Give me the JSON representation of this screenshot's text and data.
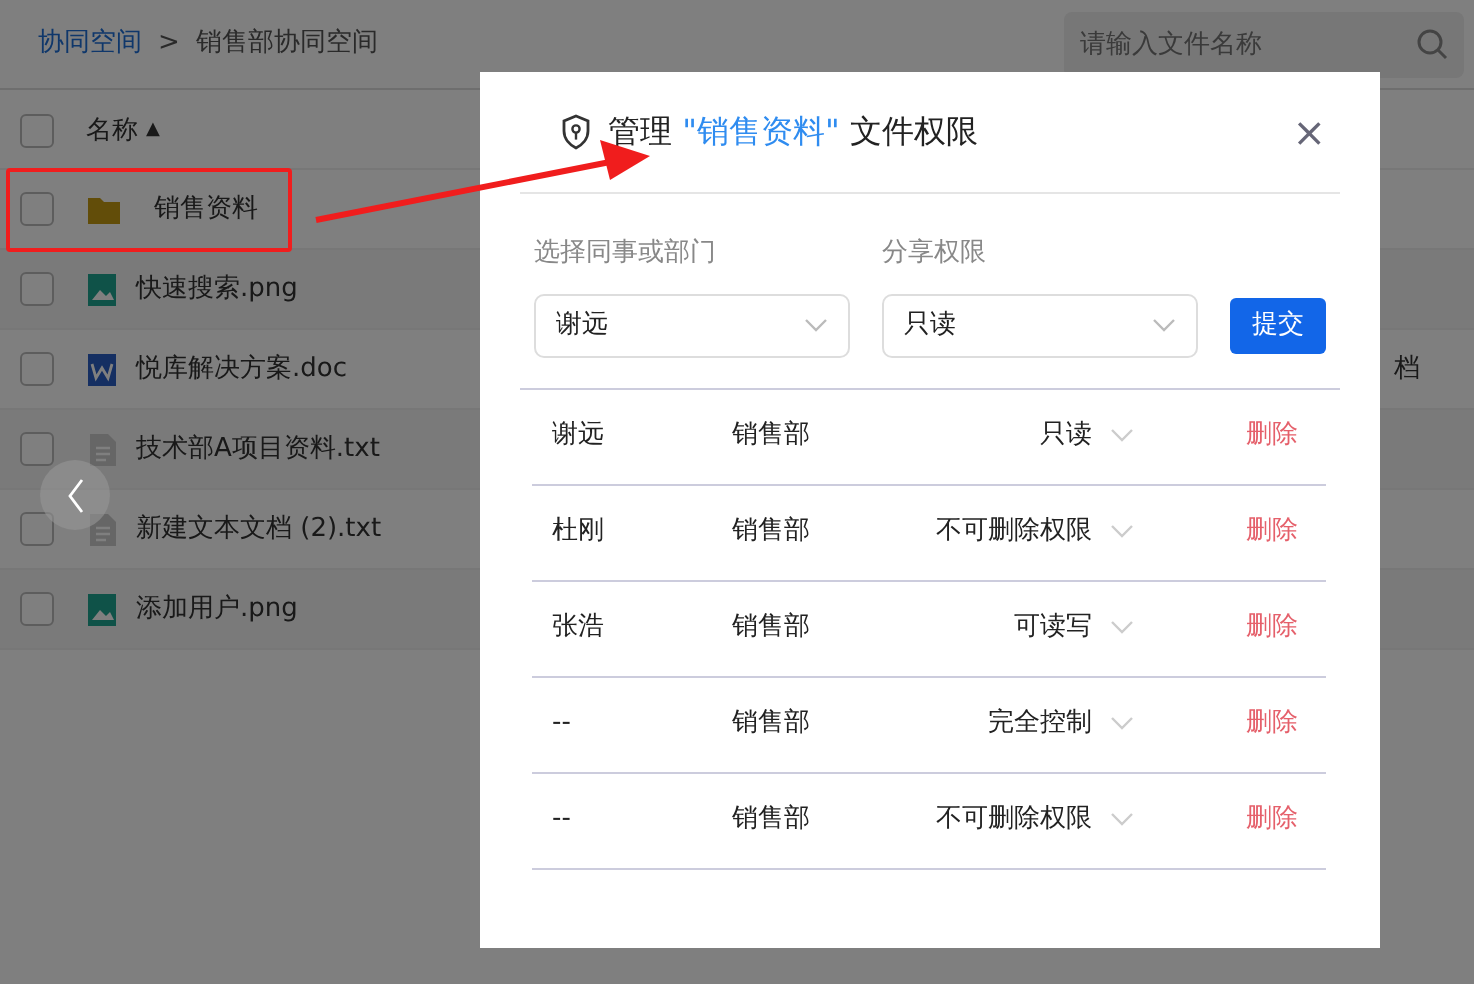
{
  "breadcrumb": {
    "items": [
      "协同空间",
      "销售部协同空间"
    ],
    "separator": ">"
  },
  "search": {
    "placeholder": "请输入文件名称"
  },
  "file_table": {
    "header": {
      "label": "名称",
      "sort": "▲",
      "checked": false
    },
    "rows": [
      {
        "name": "销售资料",
        "kind": "folder",
        "checked": false,
        "highlighted": true
      },
      {
        "name": "快速搜索.png",
        "kind": "image",
        "checked": false,
        "highlighted": false
      },
      {
        "name": "悦库解决方案.doc",
        "kind": "word",
        "checked": false,
        "highlighted": false,
        "column_2": "档"
      },
      {
        "name": "技术部A项目资料.txt",
        "kind": "text",
        "checked": false,
        "highlighted": false
      },
      {
        "name": "新建文本文档 (2).txt",
        "kind": "text",
        "checked": false,
        "highlighted": false
      },
      {
        "name": "添加用户.png",
        "kind": "image",
        "checked": false,
        "highlighted": false
      }
    ]
  },
  "dialog": {
    "title": [
      {
        "text": "管理",
        "highlight": false
      },
      {
        "text": "\"销售资料\"",
        "highlight": true
      },
      {
        "text": "文件权限",
        "highlight": false
      }
    ],
    "close": "×",
    "fields": [
      {
        "label": "选择同事或部门",
        "value": "谢远"
      },
      {
        "label": "分享权限",
        "value": "只读"
      }
    ],
    "submit": "提交",
    "permissions": [
      {
        "name": "谢远",
        "department": "销售部",
        "permission": "只读",
        "action": "删除"
      },
      {
        "name": "杜刚",
        "department": "销售部",
        "permission": "不可删除权限",
        "action": "删除"
      },
      {
        "name": "张浩",
        "department": "销售部",
        "permission": "可读写",
        "action": "删除"
      },
      {
        "name": "--",
        "department": "销售部",
        "permission": "完全控制",
        "action": "删除"
      },
      {
        "name": "--",
        "department": "销售部",
        "permission": "不可删除权限",
        "action": "删除"
      }
    ]
  }
}
